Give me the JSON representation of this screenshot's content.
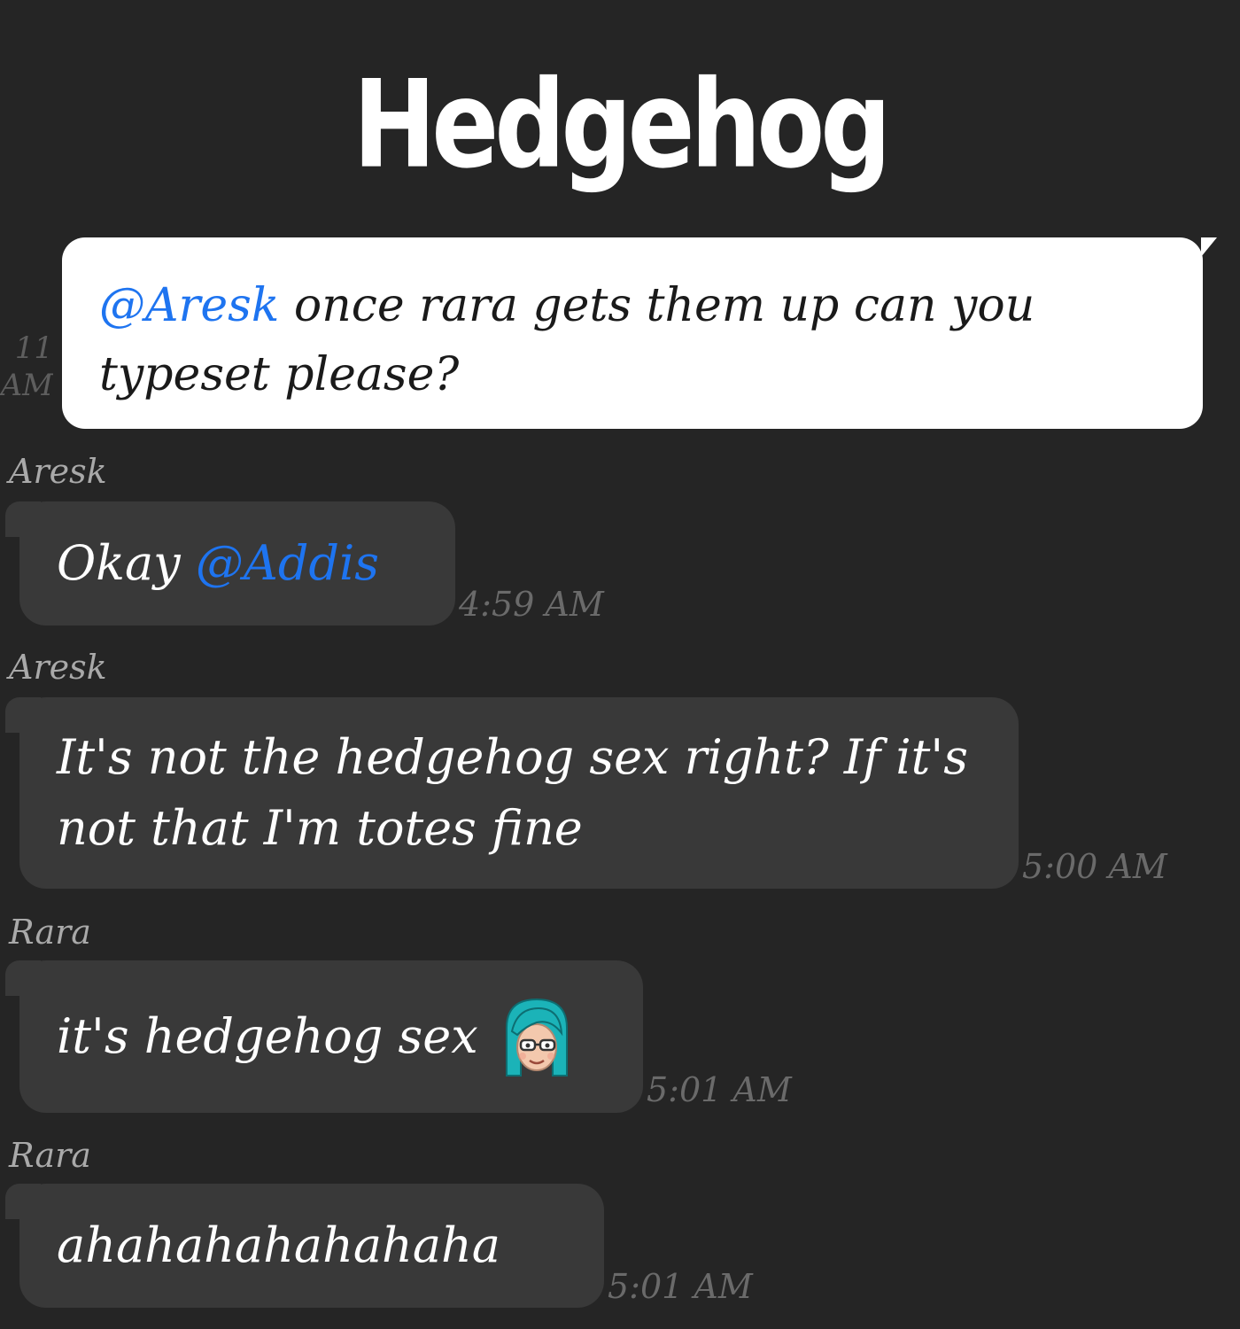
{
  "header": {
    "title": "Hedgehog"
  },
  "messages": [
    {
      "direction": "outgoing",
      "partial_time": "11 AM",
      "mention": "@Aresk",
      "text": " once rara gets them up can you typeset please?"
    },
    {
      "direction": "incoming",
      "sender": "Aresk",
      "text": "Okay ",
      "mention": "@Addis",
      "time": "4:59 AM"
    },
    {
      "direction": "incoming",
      "sender": "Aresk",
      "text": "It's not the hedgehog sex right? If it's not that I'm totes fine",
      "time": "5:00 AM"
    },
    {
      "direction": "incoming",
      "sender": "Rara",
      "text": "it's hedgehog sex",
      "emoji": "teal-haired-avatar-sticker",
      "time": "5:01 AM"
    },
    {
      "direction": "incoming",
      "sender": "Rara",
      "text": "ahahahahahahaha",
      "time": "5:01 AM"
    }
  ],
  "colors": {
    "background": "#252525",
    "incoming_bubble": "#393939",
    "outgoing_bubble": "#ffffff",
    "mention": "#1e74f0",
    "sender": "#a9a9a9",
    "timestamp": "#6a6a6a"
  }
}
